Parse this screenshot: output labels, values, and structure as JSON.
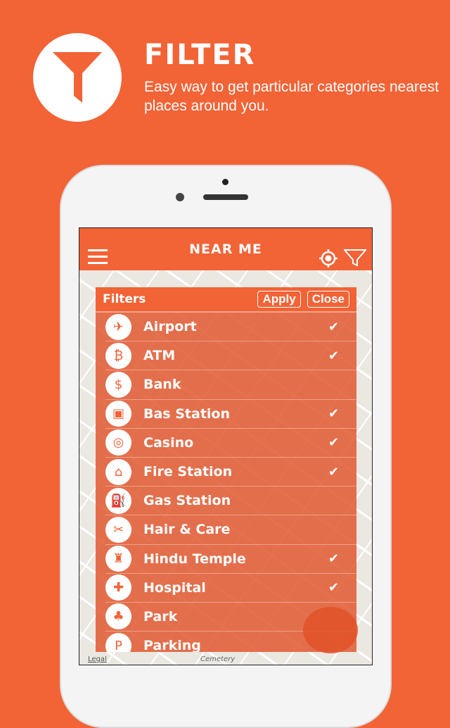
{
  "promo": {
    "title": "FILTER",
    "subtitle": "Easy way to get particular categories nearest places around you.",
    "icon": "filter-icon"
  },
  "app": {
    "title": "NEAR ME",
    "menu_icon": "hamburger-icon",
    "locate_icon": "crosshair-icon",
    "filter_icon": "filter-icon"
  },
  "filters": {
    "title": "Filters",
    "apply": "Apply",
    "close": "Close",
    "items": [
      {
        "label": "Airport",
        "icon": "✈",
        "checked": true
      },
      {
        "label": "ATM",
        "icon": "₿",
        "checked": true
      },
      {
        "label": "Bank",
        "icon": "$",
        "checked": false
      },
      {
        "label": "Bas Station",
        "icon": "▣",
        "checked": true
      },
      {
        "label": "Casino",
        "icon": "◎",
        "checked": true
      },
      {
        "label": "Fire Station",
        "icon": "⌂",
        "checked": true
      },
      {
        "label": "Gas Station",
        "icon": "⛽",
        "checked": false
      },
      {
        "label": "Hair & Care",
        "icon": "✂",
        "checked": false
      },
      {
        "label": "Hindu Temple",
        "icon": "♜",
        "checked": true
      },
      {
        "label": "Hospital",
        "icon": "✚",
        "checked": true
      },
      {
        "label": "Park",
        "icon": "♣",
        "checked": false
      },
      {
        "label": "Parking",
        "icon": "P",
        "checked": false
      }
    ]
  },
  "map": {
    "legal": "Legal",
    "label": "Cemetery"
  },
  "colors": {
    "accent": "#F26336"
  }
}
